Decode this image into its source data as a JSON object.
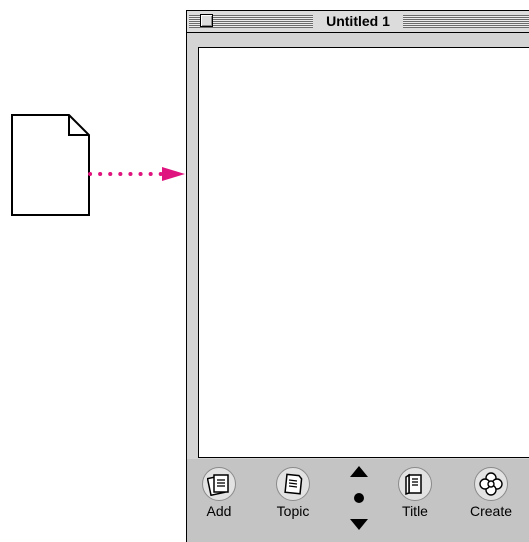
{
  "window": {
    "title": "Untitled 1"
  },
  "toolbar": {
    "add_label": "Add",
    "topic_label": "Topic",
    "title_label": "Title",
    "create_label": "Create"
  },
  "colors": {
    "arrow": "#e0147e",
    "toolbar_bg": "#c4c4c4",
    "window_frame": "#d4d4d4"
  },
  "icons": [
    "document-icon",
    "arrow-right-icon",
    "close-box-icon",
    "add-icon",
    "topic-icon",
    "scroll-up-icon",
    "scroll-dot-icon",
    "scroll-down-icon",
    "title-icon",
    "create-icon"
  ]
}
